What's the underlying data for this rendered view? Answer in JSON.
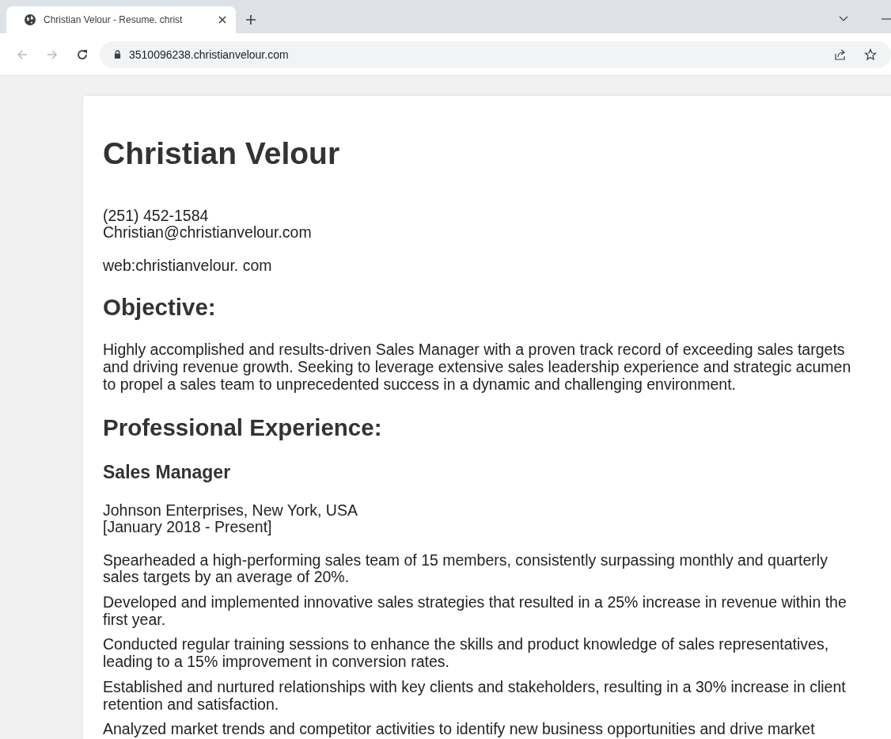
{
  "tabs": [
    {
      "title": "Christian Velour - Resume. christ",
      "selected": true
    }
  ],
  "address_bar": {
    "url": "3510096238.christianvelour.com"
  },
  "resume": {
    "name": "Christian Velour",
    "contact": [
      "(251) 452-1584",
      "Christian@christianvelour.com"
    ],
    "web": "web:christianvelour. com",
    "objective": {
      "heading": "Objective:",
      "text": "Highly accomplished and results-driven Sales Manager with a proven track record of exceeding sales targets and driving revenue growth. Seeking to leverage extensive sales leadership experience and strategic acumen to propel a sales team to unprecedented success in a dynamic and challenging environment."
    },
    "experience": {
      "heading": "Professional Experience:",
      "jobs": [
        {
          "title": "Sales Manager",
          "company": "Johnson Enterprises, New York, USA",
          "dates": "[January 2018 - Present]",
          "achievements": [
            "Spearheaded a high-performing sales team of 15 members, consistently surpassing monthly and quarterly sales targets by an average of 20%.",
            "Developed and implemented innovative sales strategies that resulted in a 25% increase in revenue within the first year.",
            "Conducted regular training sessions to enhance the skills and product knowledge of sales representatives, leading to a 15% improvement in conversion rates.",
            "Established and nurtured relationships with key clients and stakeholders, resulting in a 30% increase in client retention and satisfaction.",
            "Analyzed market trends and competitor activities to identify new business opportunities and drive market"
          ]
        }
      ]
    }
  }
}
